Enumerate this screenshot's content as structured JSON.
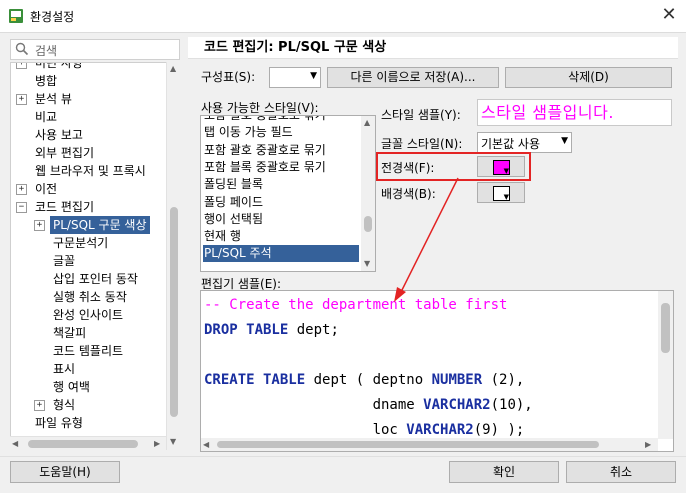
{
  "window": {
    "title": "환경설정",
    "close_glyph": "✕"
  },
  "search": {
    "placeholder": "검색",
    "icon": "search-icon"
  },
  "tree": {
    "items": [
      {
        "label": "미린 사항",
        "level": 0,
        "expander": "+"
      },
      {
        "label": "병합",
        "level": 0,
        "expander": ""
      },
      {
        "label": "분석 뷰",
        "level": 0,
        "expander": "+"
      },
      {
        "label": "비교",
        "level": 0,
        "expander": ""
      },
      {
        "label": "사용 보고",
        "level": 0,
        "expander": ""
      },
      {
        "label": "외부 편집기",
        "level": 0,
        "expander": ""
      },
      {
        "label": "웹 브라우저 및 프록시",
        "level": 0,
        "expander": ""
      },
      {
        "label": "이전",
        "level": 0,
        "expander": "+"
      },
      {
        "label": "코드 편집기",
        "level": 0,
        "expander": "−"
      },
      {
        "label": "PL/SQL 구문 색상",
        "level": 1,
        "expander": "+",
        "selected": true
      },
      {
        "label": "구문분석기",
        "level": 1,
        "expander": ""
      },
      {
        "label": "글꼴",
        "level": 1,
        "expander": ""
      },
      {
        "label": "삽입 포인터 동작",
        "level": 1,
        "expander": ""
      },
      {
        "label": "실행 취소 동작",
        "level": 1,
        "expander": ""
      },
      {
        "label": "완성 인사이트",
        "level": 1,
        "expander": ""
      },
      {
        "label": "책갈피",
        "level": 1,
        "expander": ""
      },
      {
        "label": "코드 템플리트",
        "level": 1,
        "expander": ""
      },
      {
        "label": "표시",
        "level": 1,
        "expander": ""
      },
      {
        "label": "행 여백",
        "level": 1,
        "expander": ""
      },
      {
        "label": "형식",
        "level": 1,
        "expander": "+"
      },
      {
        "label": "파일 유형",
        "level": 0,
        "expander": ""
      }
    ]
  },
  "panel": {
    "title": "코드 편집기: PL/SQL 구문 색상",
    "scheme_label": "구성표(S):",
    "scheme_value": "",
    "save_as_label": "다른 이름으로 저장(A)...",
    "delete_label": "삭제(D)",
    "styles_label": "사용 가능한 스타일(V):",
    "styles": [
      "포함 괄호 중괄호로 묶기",
      "탭 이동 가능 필드",
      "포함 괄호 중괄호로 묶기",
      "포함 블록 중괄호로 묶기",
      "폴딩된 블록",
      "폴딩 페이드",
      "행이 선택됨",
      "현재 행",
      "PL/SQL 주석"
    ],
    "selected_style_index": 8,
    "style_sample_label": "스타일 샘플(Y):",
    "style_sample_text": "스타일 샘플입니다.",
    "font_style_label": "글꼴 스타일(N):",
    "font_style_value": "기본값 사용",
    "foreground_label": "전경색(F):",
    "foreground_color": "#ff00ff",
    "background_label": "배경색(B):",
    "background_color": "#ffffff",
    "editor_sample_label": "편집기 샘플(E):"
  },
  "code_sample": [
    [
      {
        "t": "-- Create the department table first",
        "k": "comment"
      }
    ],
    [
      {
        "t": "DROP TABLE",
        "k": "kw"
      },
      {
        "t": " dept;",
        "k": "plain"
      }
    ],
    [],
    [
      {
        "t": "CREATE TABLE",
        "k": "kw"
      },
      {
        "t": " dept ( deptno ",
        "k": "plain"
      },
      {
        "t": "NUMBER",
        "k": "kw"
      },
      {
        "t": " (2),",
        "k": "plain"
      }
    ],
    [
      {
        "t": "                    dname ",
        "k": "plain"
      },
      {
        "t": "VARCHAR2",
        "k": "kw"
      },
      {
        "t": "(10),",
        "k": "plain"
      }
    ],
    [
      {
        "t": "                    loc ",
        "k": "plain"
      },
      {
        "t": "VARCHAR2",
        "k": "kw"
      },
      {
        "t": "(9) );",
        "k": "plain"
      }
    ]
  ],
  "footer": {
    "help_label": "도움말(H)",
    "ok_label": "확인",
    "cancel_label": "취소"
  },
  "colors": {
    "selection": "#35619a",
    "comment": "#ff00ff",
    "keyword": "#1a2fa0",
    "annotation": "#e32424"
  }
}
